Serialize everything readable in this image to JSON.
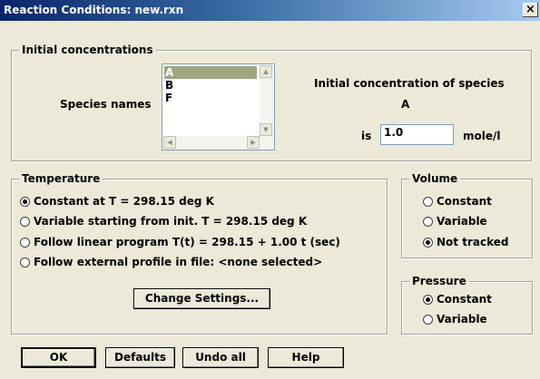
{
  "window": {
    "title": "Reaction Conditions: new.rxn",
    "close": "×"
  },
  "initial": {
    "group_label": "Initial concentrations",
    "species_label": "Species names",
    "species": [
      "A",
      "B",
      "F"
    ],
    "selected_species": "A",
    "conc_heading": "Initial concentration of species",
    "conc_species": "A",
    "is_label": "is",
    "conc_value": "1.0",
    "unit": "mole/l"
  },
  "temperature": {
    "group_label": "Temperature",
    "options": [
      "Constant at T = 298.15 deg K",
      "Variable starting from init. T = 298.15 deg K",
      "Follow linear program T(t) = 298.15 + 1.00 t (sec)",
      "Follow external profile in file: <none selected>"
    ],
    "selected": 0,
    "change_button": "Change Settings..."
  },
  "volume": {
    "group_label": "Volume",
    "options": [
      "Constant",
      "Variable",
      "Not tracked"
    ],
    "selected": 2
  },
  "pressure": {
    "group_label": "Pressure",
    "options": [
      "Constant",
      "Variable"
    ],
    "selected": 0
  },
  "buttons": {
    "ok": "OK",
    "defaults": "Defaults",
    "undo_all": "Undo all",
    "help": "Help"
  },
  "icons": {
    "close": "close-icon",
    "scroll_up": "scroll-up-icon",
    "scroll_down": "scroll-down-icon",
    "scroll_left": "scroll-left-icon",
    "scroll_right": "scroll-right-icon"
  }
}
